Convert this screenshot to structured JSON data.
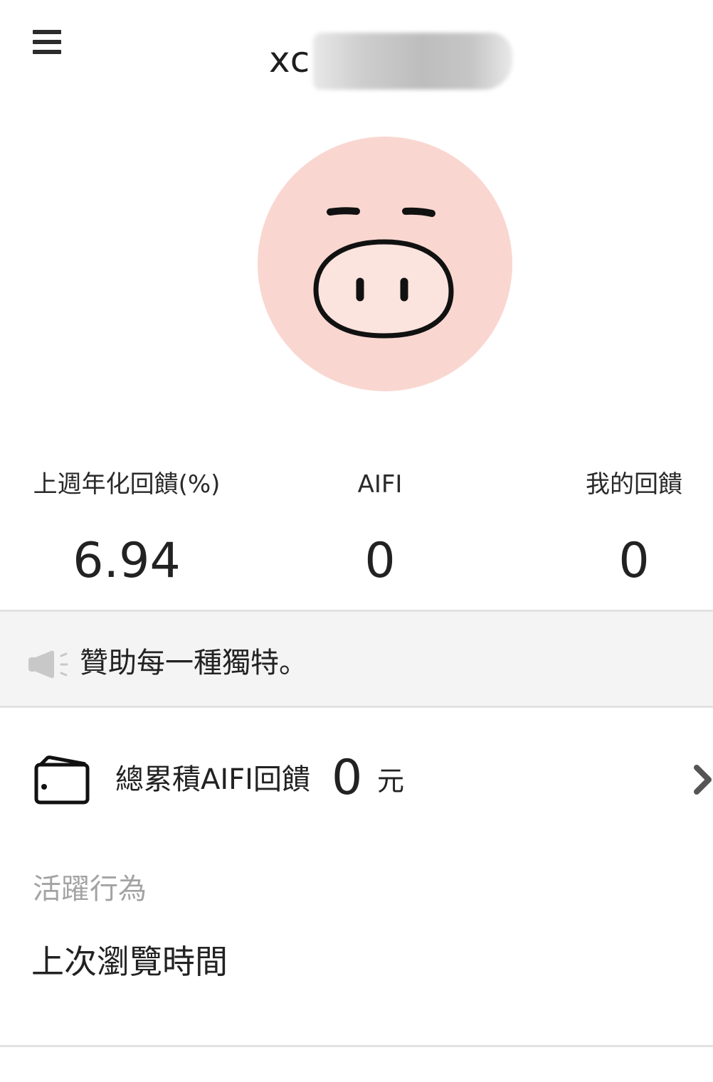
{
  "header": {
    "menu_icon": "hamburger-menu-icon",
    "user_name": "xc"
  },
  "avatar": {
    "icon": "pig-face-avatar",
    "background_color": "#f9d7d0"
  },
  "stats": [
    {
      "label": "上週年化回饋(%)",
      "value": "6.94"
    },
    {
      "label": "AIFI",
      "value": "0"
    },
    {
      "label": "我的回饋",
      "value": "0"
    }
  ],
  "announcement": {
    "icon": "megaphone-icon",
    "text": "贊助每一種獨特。"
  },
  "reward": {
    "icon": "wallet-icon",
    "label": "總累積AIFI回饋",
    "value": "0",
    "unit": "元",
    "chevron_icon": "chevron-right-icon"
  },
  "activity": {
    "heading": "活躍行為",
    "last_browse_label": "上次瀏覽時間"
  }
}
